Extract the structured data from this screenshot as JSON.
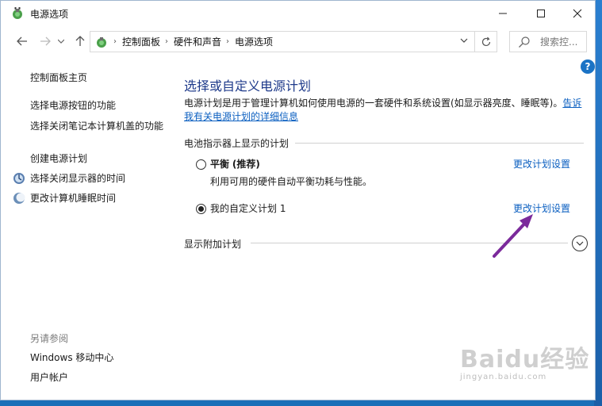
{
  "window": {
    "title": "电源选项"
  },
  "address": {
    "breadcrumbs": [
      "控制面板",
      "硬件和声音",
      "电源选项"
    ],
    "search_placeholder": "搜索控..."
  },
  "leftnav": {
    "home": "控制面板主页",
    "items": [
      {
        "label": "选择电源按钮的功能"
      },
      {
        "label": "选择关闭笔记本计算机盖的功能"
      },
      {
        "label": "创建电源计划"
      },
      {
        "label": "选择关闭显示器的时间",
        "icon": "display-icon"
      },
      {
        "label": "更改计算机睡眠时间",
        "icon": "moon-icon"
      }
    ],
    "see_also": "另请参阅",
    "see_also_items": [
      {
        "label": "Windows 移动中心"
      },
      {
        "label": "用户帐户"
      }
    ]
  },
  "main": {
    "title": "选择或自定义电源计划",
    "description_line1": "电源计划是用于管理计算机如何使用电源的一套硬件和系统设置(如显示器亮度、睡眠等)。",
    "description_link_part1": "告诉",
    "description_link_part2": "我有关电源计划的详细信息",
    "battery_section": "电池指示器上显示的计划",
    "plans": [
      {
        "name": "平衡",
        "tag": "(推荐)",
        "desc": "利用可用的硬件自动平衡功耗与性能。",
        "selected": false,
        "link": "更改计划设置"
      },
      {
        "name": "我的自定义计划 1",
        "tag": "",
        "desc": "",
        "selected": true,
        "link": "更改计划设置"
      }
    ],
    "show_more": "显示附加计划"
  },
  "colors": {
    "title": "#1e3a8a",
    "link": "#0b5fc0",
    "arrow": "#7b2a9b"
  },
  "watermark": {
    "main": "Baidu经验",
    "sub": "jingyan.baidu.com"
  }
}
